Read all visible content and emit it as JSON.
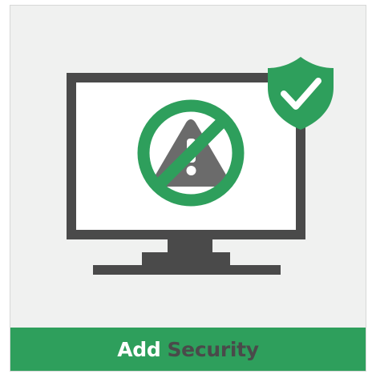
{
  "banner": {
    "word_primary": "Add",
    "word_secondary": "Security"
  },
  "icons": {
    "monitor": "monitor-icon",
    "warning": "warning-triangle-icon",
    "prohibit": "prohibited-icon",
    "shield": "shield-check-icon"
  },
  "colors": {
    "background": "#f0f1f0",
    "accent_green": "#2e9f5c",
    "dark_gray": "#4a4a4a",
    "triangle_gray": "#6b6b6b",
    "white": "#ffffff"
  }
}
